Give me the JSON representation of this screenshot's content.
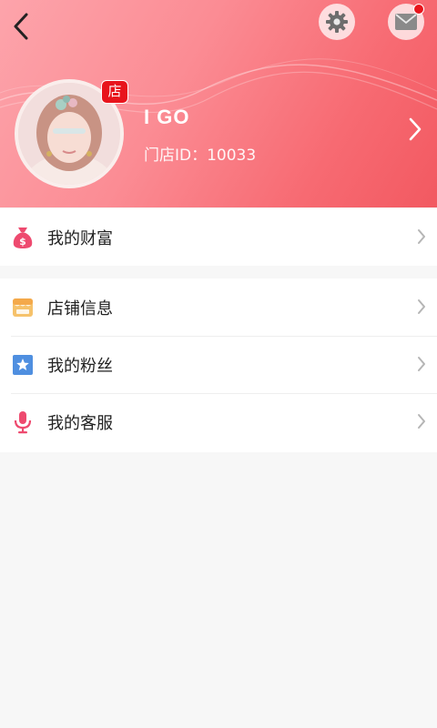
{
  "header": {
    "username": "I GO",
    "store_id_label": "门店ID：",
    "store_id_value": "10033",
    "shop_badge": "店",
    "colors": {
      "gradient_start": "#fda4ab",
      "gradient_end": "#f25961",
      "badge": "#e8141c"
    }
  },
  "toolbar": {
    "back_icon": "chevron-left-icon",
    "settings_icon": "gear-icon",
    "mail_icon": "mail-icon",
    "has_notification": true
  },
  "menu": {
    "group1": [
      {
        "label": "我的财富",
        "icon": "money-bag-icon",
        "color": "#ee4a6f"
      }
    ],
    "group2": [
      {
        "label": "店铺信息",
        "icon": "store-icon",
        "color": "#f6c26b"
      },
      {
        "label": "我的粉丝",
        "icon": "star-icon",
        "color": "#4f8fe0"
      },
      {
        "label": "我的客服",
        "icon": "microphone-icon",
        "color": "#ee4a6f"
      }
    ]
  }
}
